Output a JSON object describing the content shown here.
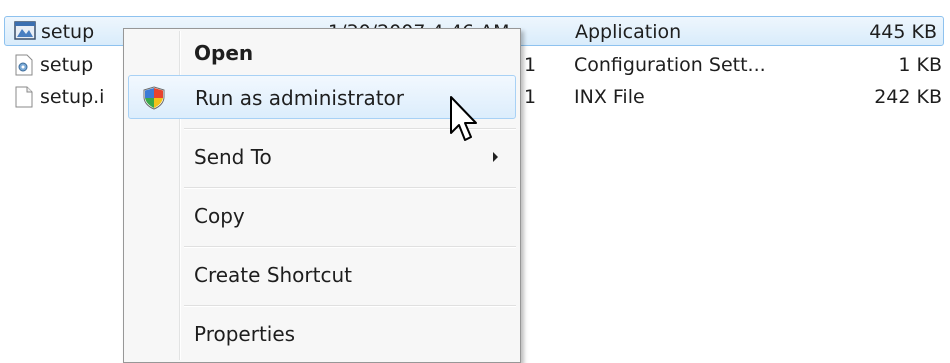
{
  "files": [
    {
      "name": "setup",
      "date": "1/30/2007 4:46 AM",
      "type": "Application",
      "size": "445 KB",
      "icon": "application-icon",
      "selected": true
    },
    {
      "name": "setup",
      "date": "1",
      "type": "Configuration Sett...",
      "size": "1 KB",
      "icon": "config-file-icon",
      "selected": false
    },
    {
      "name": "setup.i",
      "date": "1",
      "type": "INX File",
      "size": "242 KB",
      "icon": "file-icon",
      "selected": false
    }
  ],
  "context_menu": {
    "open": "Open",
    "run_as_admin": "Run as administrator",
    "send_to": "Send To",
    "copy": "Copy",
    "create_shortcut": "Create Shortcut",
    "properties": "Properties"
  },
  "colors": {
    "selection": "#d9ecfb",
    "selection_border": "#8ec2ef",
    "menu_bg": "#f7f7f7"
  }
}
